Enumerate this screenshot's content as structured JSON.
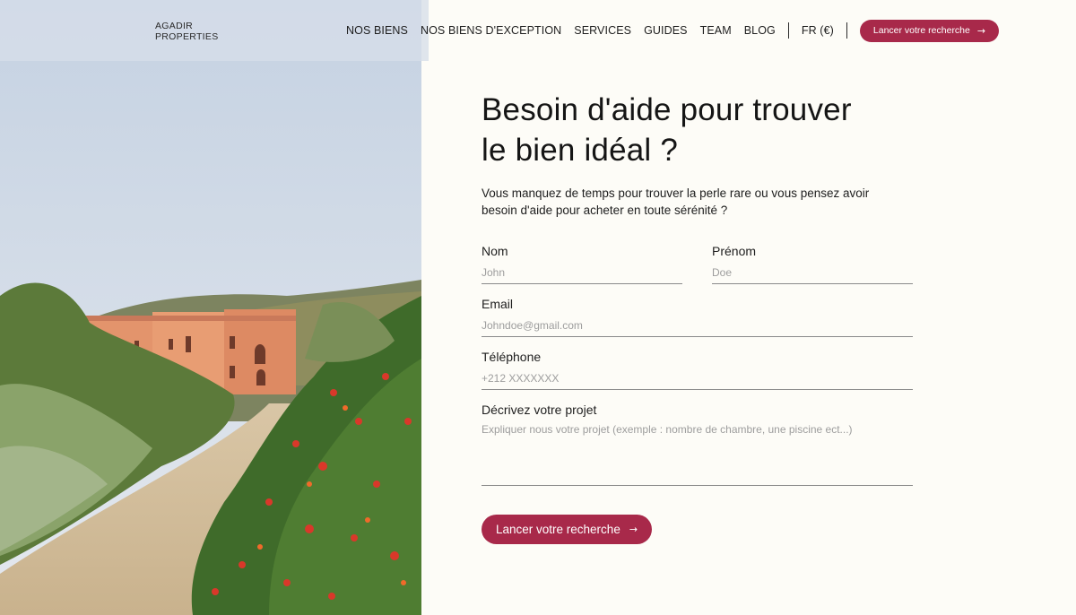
{
  "header": {
    "logo_line1": "AGADIR",
    "logo_line2": "PROPERTIES",
    "nav": [
      "NOS BIENS",
      "NOS BIENS D'EXCEPTION",
      "SERVICES",
      "GUIDES",
      "TEAM",
      "BLOG"
    ],
    "lang": "FR (€)",
    "cta_label": "Lancer votre recherche"
  },
  "hero": {
    "title": "Besoin d'aide pour trouver le bien idéal ?",
    "lead": "Vous manquez de temps pour trouver la perle rare ou vous pensez avoir besoin d'aide pour acheter en toute sérénité ?"
  },
  "form": {
    "nom": {
      "label": "Nom",
      "placeholder": "John"
    },
    "prenom": {
      "label": "Prénom",
      "placeholder": "Doe"
    },
    "email": {
      "label": "Email",
      "placeholder": "Johndoe@gmail.com"
    },
    "telephone": {
      "label": "Téléphone",
      "placeholder": "+212 XXXXXXX"
    },
    "projet": {
      "label": "Décrivez votre projet",
      "placeholder": "Expliquer nous votre projet (exemple : nombre de chambre, une piscine ect...)"
    },
    "submit_label": "Lancer votre recherche"
  },
  "icons": {
    "arrow": "arrow-right-icon"
  },
  "colors": {
    "accent": "#a8294a",
    "background": "#fdfcf7"
  }
}
